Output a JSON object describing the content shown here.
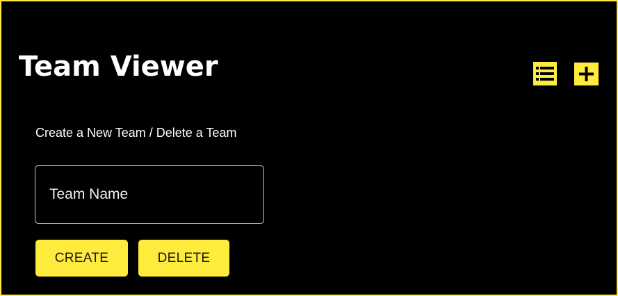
{
  "header": {
    "title": "Team Viewer",
    "list_icon": "list-icon",
    "add_icon": "plus-icon"
  },
  "form": {
    "subtitle": "Create a New Team / Delete a Team",
    "team_name_placeholder": "Team Name",
    "team_name_value": "",
    "create_label": "CREATE",
    "delete_label": "DELETE"
  },
  "colors": {
    "background": "#000000",
    "accent": "#ffeb3b",
    "text": "#ffffff",
    "button_text": "#1a1a1a"
  }
}
